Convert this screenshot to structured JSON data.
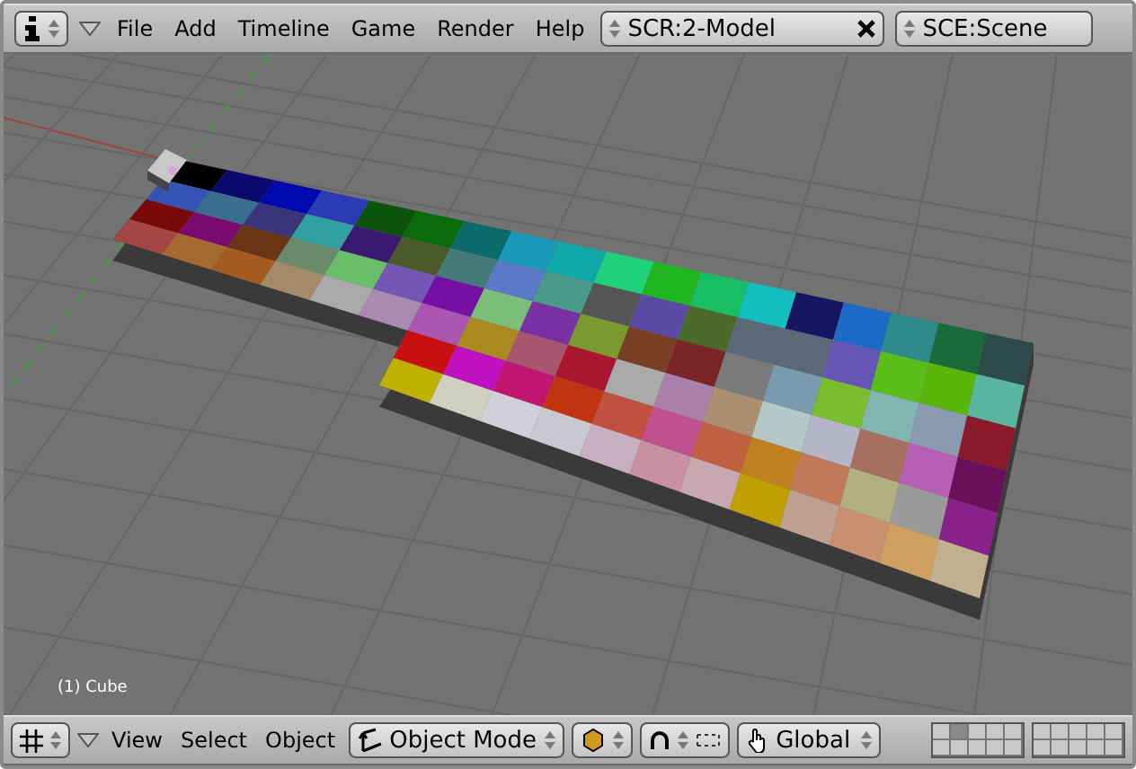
{
  "top_header": {
    "menu": [
      "File",
      "Add",
      "Timeline",
      "Game",
      "Render",
      "Help"
    ],
    "screen_field": "SCR:2-Model",
    "scene_field": "SCE:Scene"
  },
  "viewport": {
    "object_label": "(1) Cube"
  },
  "bottom_header": {
    "menu": [
      "View",
      "Select",
      "Object"
    ],
    "mode": "Object Mode",
    "orientation": "Global",
    "layers": [
      {
        "selected": false
      },
      {
        "selected": true
      },
      {
        "selected": false
      },
      {
        "selected": false
      },
      {
        "selected": false
      },
      {
        "selected": false
      },
      {
        "selected": false
      },
      {
        "selected": false
      },
      {
        "selected": false
      },
      {
        "selected": false
      },
      {
        "selected": false
      },
      {
        "selected": false
      },
      {
        "selected": false
      },
      {
        "selected": false
      },
      {
        "selected": false
      },
      {
        "selected": false
      },
      {
        "selected": false
      },
      {
        "selected": false
      },
      {
        "selected": false
      },
      {
        "selected": false
      }
    ]
  }
}
